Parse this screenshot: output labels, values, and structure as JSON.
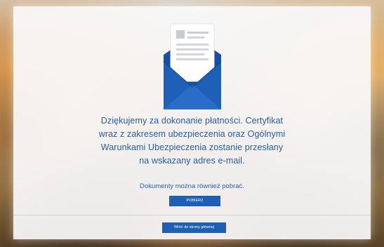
{
  "message": {
    "line1": "Dziękujemy za dokonanie płatności. Certyfikat",
    "line2": "wraz z zakresem ubezpieczenia oraz Ogólnymi",
    "line3": "Warunkami Ubezpieczenia zostanie przesłany",
    "line4": "na wskazany adres e-mail."
  },
  "download_note": "Dokumenty można również pobrać.",
  "buttons": {
    "download_label": "POBIERZ",
    "home_label": "Wróć do strony głównej"
  },
  "colors": {
    "accent": "#1f5fb3",
    "text": "#2a5c9e"
  },
  "icons": {
    "hero": "envelope-with-letter-icon"
  }
}
